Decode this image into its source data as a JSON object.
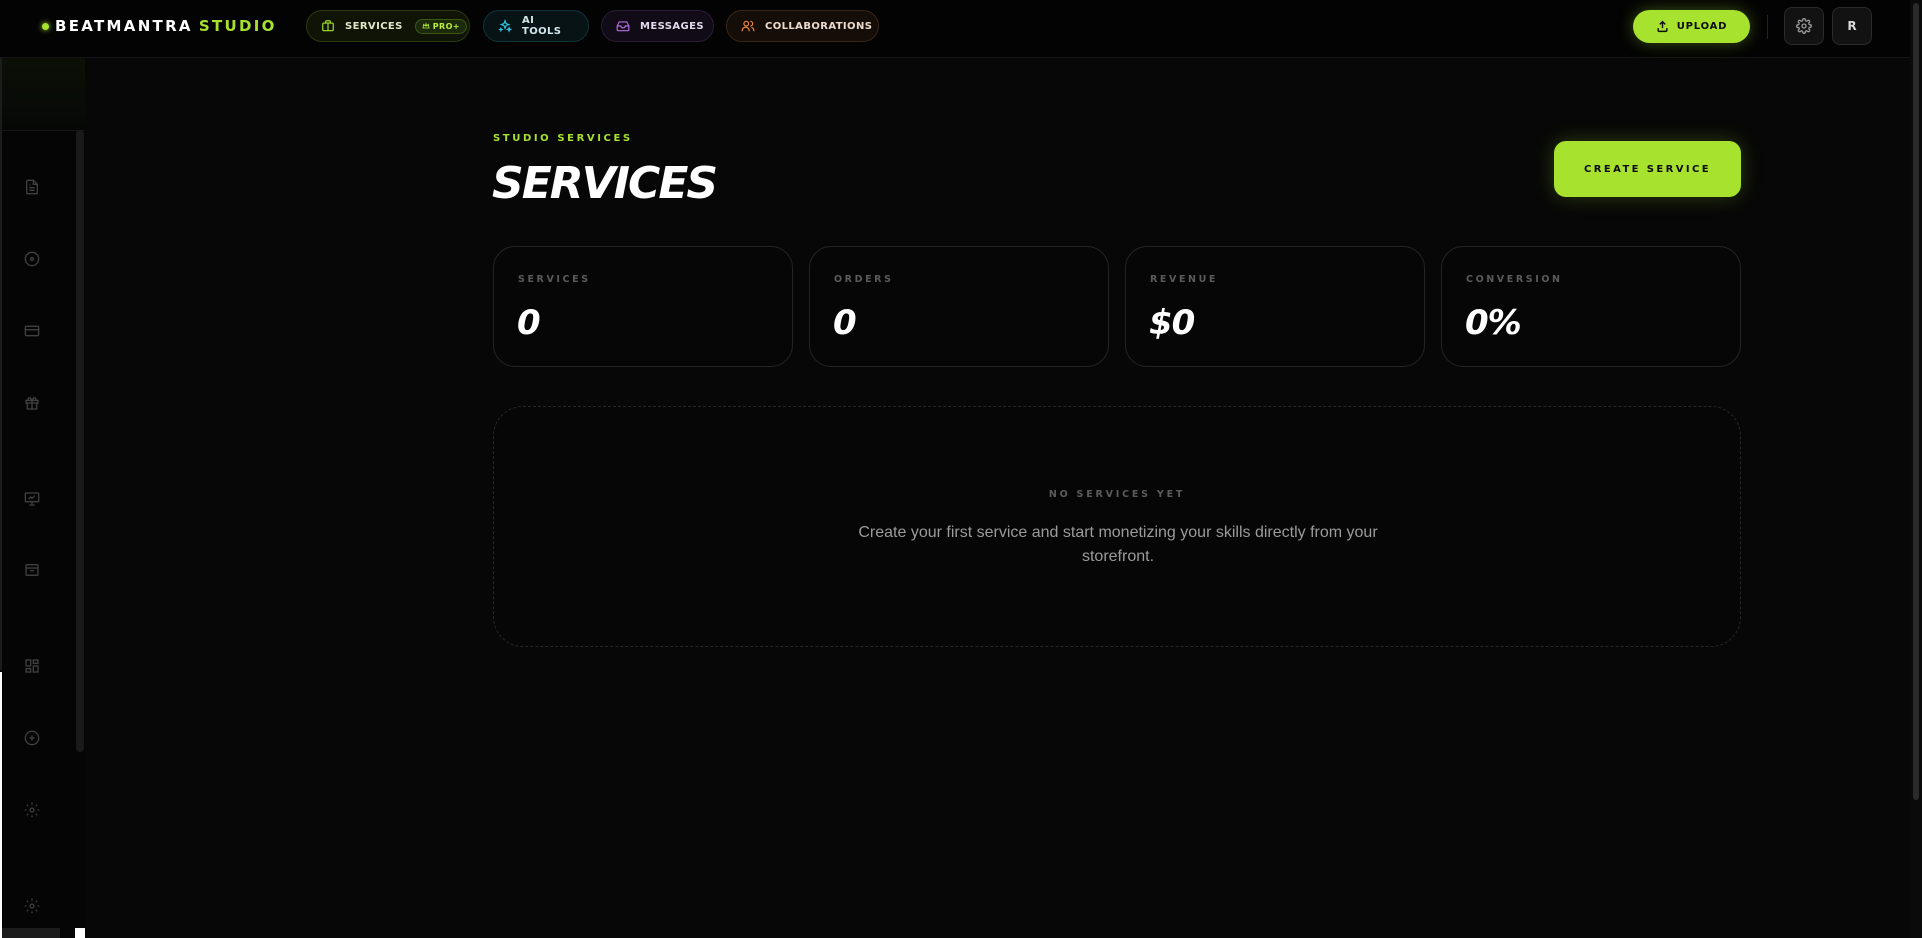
{
  "brand": {
    "name_part1": "BEATMANTRA",
    "name_part2": "STUDIO",
    "accent": "#a6e22e"
  },
  "nav": {
    "services": {
      "label": "SERVICES",
      "badge": "PRO+",
      "icon": "briefcase-icon"
    },
    "ai_tools": {
      "label": "AI TOOLS",
      "icon": "sparkles-icon"
    },
    "messages": {
      "label": "MESSAGES",
      "icon": "inbox-icon"
    },
    "collaborations": {
      "label": "COLLABORATIONS",
      "icon": "users-icon"
    }
  },
  "header_actions": {
    "upload_label": "UPLOAD",
    "settings_icon": "gear-icon",
    "avatar_initial": "R"
  },
  "sidebar": {
    "icons": [
      "document-icon",
      "disc-icon",
      "credit-card-icon",
      "gift-icon",
      "presentation-icon",
      "archive-icon",
      "grid-icon",
      "plus-circle-icon",
      "gear-icon",
      "gear-icon"
    ]
  },
  "page": {
    "eyebrow": "STUDIO SERVICES",
    "title": "SERVICES",
    "create_button": "CREATE SERVICE"
  },
  "stats": [
    {
      "label": "SERVICES",
      "value": "0"
    },
    {
      "label": "ORDERS",
      "value": "0"
    },
    {
      "label": "REVENUE",
      "value": "$0"
    },
    {
      "label": "CONVERSION",
      "value": "0%"
    }
  ],
  "empty_state": {
    "title": "NO SERVICES YET",
    "description": "Create your first service and start monetizing your skills directly from your storefront."
  }
}
